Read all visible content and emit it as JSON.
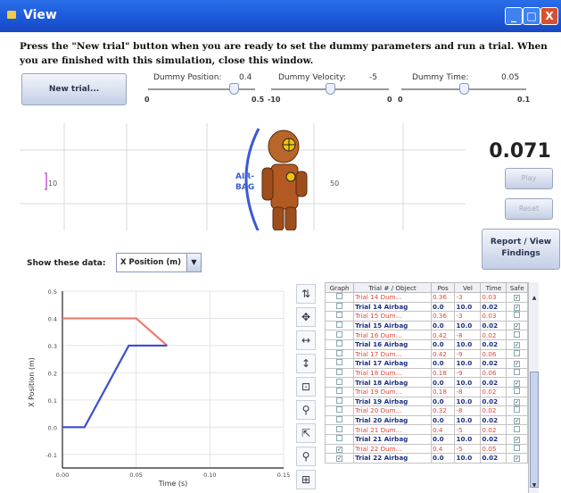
{
  "window": {
    "title": "View",
    "minimize_glyph": "_",
    "maximize_glyph": "□",
    "close_glyph": "X"
  },
  "instructions": "Press the \"New trial\" button when you are ready to set the dummy parameters and run a trial.  When you are finished with this simulation, close this window.",
  "controls": {
    "new_trial_label": "New trial...",
    "sliders": [
      {
        "label": "Dummy Position:",
        "value": "0.4",
        "min": "0",
        "max": "0.5",
        "level": 0.8
      },
      {
        "label": "Dummy Velocity:",
        "value": "-5",
        "min": "-10",
        "max": "0",
        "level": 0.5
      },
      {
        "label": "Dummy Time:",
        "value": "0.05",
        "min": "0",
        "max": "0.1",
        "level": 0.5
      }
    ]
  },
  "arena": {
    "left_marker": "10",
    "right_marker": "50",
    "airbag_label_1": "AIR-",
    "airbag_label_2": "BAG"
  },
  "playback": {
    "time": "0.071",
    "play_label": "Play",
    "reset_label": "Reset",
    "report_label_1": "Report / View",
    "report_label_2": "Findings"
  },
  "data_select": {
    "label": "Show these data:",
    "selected": "X Position (m)"
  },
  "chart_data": {
    "type": "line",
    "xlabel": "Time (s)",
    "ylabel": "X Position (m)",
    "xlim": [
      0,
      0.15
    ],
    "ylim": [
      -0.15,
      0.5
    ],
    "xticks": [
      "0.00",
      "0.05",
      "0.10",
      "0.15"
    ],
    "yticks": [
      "0.5",
      "0.4",
      "0.3",
      "0.2",
      "0.1",
      "0.0",
      "-0.1"
    ],
    "series": [
      {
        "color": "#f07a6e",
        "x": [
          0,
          0.05,
          0.071
        ],
        "y": [
          0.4,
          0.4,
          0.3
        ]
      },
      {
        "color": "#3a4fd0",
        "x": [
          0,
          0.015,
          0.045,
          0.06,
          0.071
        ],
        "y": [
          0,
          0,
          0.3,
          0.3,
          0.3
        ]
      }
    ]
  },
  "tools": [
    "zoom-fit-icon",
    "pan-icon",
    "zoom-horizontal-icon",
    "zoom-vertical-icon",
    "zoom-extents-icon",
    "zoom-in-icon",
    "select-icon",
    "zoom-out-icon",
    "grid-icon"
  ],
  "table": {
    "headers": [
      "Graph",
      "Trial # / Object",
      "Pos",
      "Vel",
      "Time",
      "Safe"
    ],
    "rows": [
      {
        "kind": "dummy",
        "graph": false,
        "obj": "Trial 14 Dum...",
        "pos": "0.36",
        "vel": "-3",
        "time": "0.03",
        "safe": true
      },
      {
        "kind": "airbag",
        "graph": false,
        "obj": "Trial 14 Airbag",
        "pos": "0.0",
        "vel": "10.0",
        "time": "0.02",
        "safe": true
      },
      {
        "kind": "dummy",
        "graph": false,
        "obj": "Trial 15 Dum...",
        "pos": "0.36",
        "vel": "-3",
        "time": "0.03",
        "safe": false
      },
      {
        "kind": "airbag",
        "graph": false,
        "obj": "Trial 15 Airbag",
        "pos": "0.0",
        "vel": "10.0",
        "time": "0.02",
        "safe": true
      },
      {
        "kind": "dummy",
        "graph": false,
        "obj": "Trial 16 Dum...",
        "pos": "0.42",
        "vel": "-8",
        "time": "0.02",
        "safe": false
      },
      {
        "kind": "airbag",
        "graph": false,
        "obj": "Trial 16 Airbag",
        "pos": "0.0",
        "vel": "10.0",
        "time": "0.02",
        "safe": true
      },
      {
        "kind": "dummy",
        "graph": false,
        "obj": "Trial 17 Dum...",
        "pos": "0.42",
        "vel": "-9",
        "time": "0.06",
        "safe": false
      },
      {
        "kind": "airbag",
        "graph": false,
        "obj": "Trial 17 Airbag",
        "pos": "0.0",
        "vel": "10.0",
        "time": "0.02",
        "safe": true
      },
      {
        "kind": "dummy",
        "graph": false,
        "obj": "Trial 18 Dum...",
        "pos": "0.18",
        "vel": "-9",
        "time": "0.06",
        "safe": false
      },
      {
        "kind": "airbag",
        "graph": false,
        "obj": "Trial 18 Airbag",
        "pos": "0.0",
        "vel": "10.0",
        "time": "0.02",
        "safe": true
      },
      {
        "kind": "dummy",
        "graph": false,
        "obj": "Trial 19 Dum...",
        "pos": "0.18",
        "vel": "-8",
        "time": "0.02",
        "safe": false
      },
      {
        "kind": "airbag",
        "graph": false,
        "obj": "Trial 19 Airbag",
        "pos": "0.0",
        "vel": "10.0",
        "time": "0.02",
        "safe": true
      },
      {
        "kind": "dummy",
        "graph": false,
        "obj": "Trial 20 Dum...",
        "pos": "0.32",
        "vel": "-8",
        "time": "0.02",
        "safe": false
      },
      {
        "kind": "airbag",
        "graph": false,
        "obj": "Trial 20 Airbag",
        "pos": "0.0",
        "vel": "10.0",
        "time": "0.02",
        "safe": true
      },
      {
        "kind": "dummy",
        "graph": false,
        "obj": "Trial 21 Dum...",
        "pos": "0.4",
        "vel": "-5",
        "time": "0.02",
        "safe": false
      },
      {
        "kind": "airbag",
        "graph": false,
        "obj": "Trial 21 Airbag",
        "pos": "0.0",
        "vel": "10.0",
        "time": "0.02",
        "safe": true
      },
      {
        "kind": "dummy",
        "graph": true,
        "obj": "Trial 22 Dum...",
        "pos": "0.4",
        "vel": "-5",
        "time": "0.05",
        "safe": false
      },
      {
        "kind": "airbag",
        "graph": true,
        "obj": "Trial 22 Airbag",
        "pos": "0.0",
        "vel": "10.0",
        "time": "0.02",
        "safe": true
      }
    ]
  }
}
